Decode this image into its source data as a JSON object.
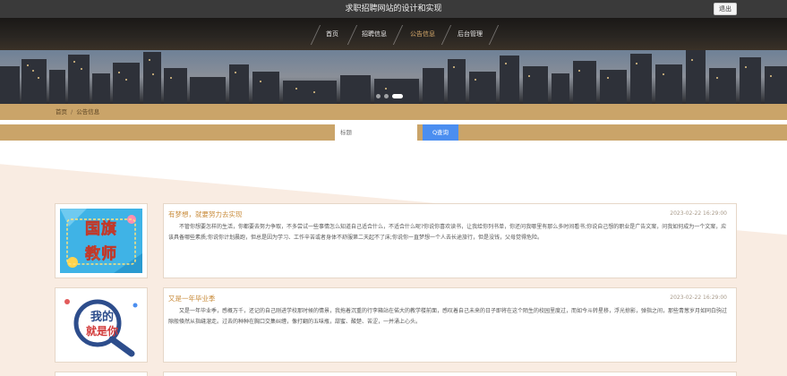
{
  "header": {
    "site_title": "求职招聘网站的设计和实现",
    "logout_label": "退出"
  },
  "nav": [
    {
      "label": "首页"
    },
    {
      "label": "招聘信息"
    },
    {
      "label": "公告信息"
    },
    {
      "label": "后台管理"
    }
  ],
  "active_nav": "公告信息",
  "breadcrumb": {
    "home": "首页",
    "current": "公告信息"
  },
  "search": {
    "placeholder": "标题",
    "button_label": "Q查询"
  },
  "notices": [
    {
      "title": "有梦想，就要努力去实现",
      "time": "2023-02-22 16:29:00",
      "summary": "不管你想要怎样的生活，你都要去努力争取，不多尝试一些事情怎么知道自己适合什么，不适合什么呢?你说你喜欢读书，让我给你列书单，你还问我哪里有那么多时间看书;你说自己想的职业是广告文案，问我如何成为一个文案，应该具备哪些素质;你说你计划晨跑，但总是因为学习、工作辛苦或者身体不舒服第二天起不了床;你说你一直梦想一个人去长途旅行，但是没钱，父母觉得危险。",
      "thumb_text": [
        "国旗",
        "教师"
      ]
    },
    {
      "title": "又是一年毕业季",
      "time": "2023-02-22 16:29:00",
      "summary": "又是一年毕业季，感概万千，还记的自己刚进学校那时候的情景，我拖着沉重的行李箱站在偌大的教学楼前面，感叹着自己未来的日子即将在这个陌生的校园里度过，而如今斗转星移，浮光掠影，弹指之间，那些青葱岁月如同白驹过隙般倏然从指缝溜走。过去的种种在胸口交集纠缠，像打翻的五味瓶，甜蜜、酸楚、苦涩，一并涌上心头。",
      "thumb_text": [
        "我的",
        "就是你"
      ]
    }
  ],
  "colors": {
    "accent": "#caa469",
    "title": "#c88b3a",
    "button": "#4b8ef0",
    "topbar": "#3a3a3a"
  }
}
